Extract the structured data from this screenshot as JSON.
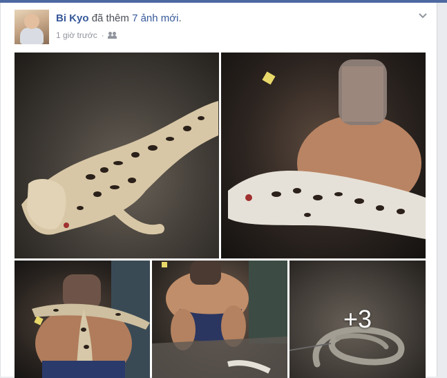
{
  "post": {
    "author": "Bi Kyo",
    "action": "đã thêm",
    "photo_count": "7 ảnh mới",
    "period": ".",
    "time": "1 giờ trước",
    "separator": "·",
    "privacy_icon": "friends-icon",
    "menu_icon": "chevron-down-icon"
  },
  "photos": {
    "more_count": "+3"
  },
  "colors": {
    "link": "#365899",
    "meta": "#90949c",
    "topbar": "#4e69a2"
  }
}
